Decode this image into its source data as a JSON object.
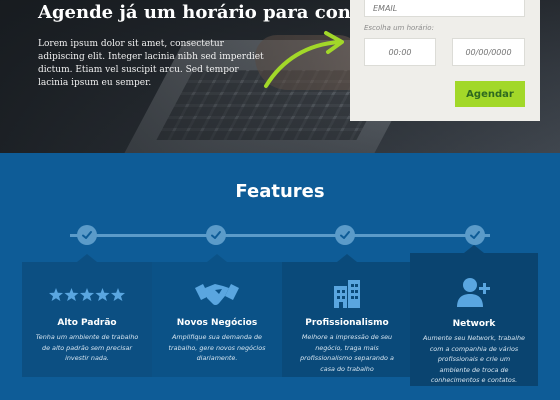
{
  "hero": {
    "title": "Agende já um horário para conhecer!",
    "text": "Lorem ipsum dolor sit amet, consectetur adipiscing elit. Integer lacinia nibh sed imperdiet dictum. Etiam vel suscipit arcu. Sed tempor lacinia ipsum eu semper."
  },
  "form": {
    "email_placeholder": "EMAIL",
    "schedule_label": "Escolha um horário:",
    "time_placeholder": "00:00",
    "date_placeholder": "00/00/0000",
    "submit_label": "Agendar"
  },
  "features": {
    "title": "Features",
    "cards": [
      {
        "icon": "stars-icon",
        "title": "Alto Padrão",
        "text": "Tenha um ambiente de trabalho de alto padrão sem precisar investir nada."
      },
      {
        "icon": "handshake-icon",
        "title": "Novos Negócios",
        "text": "Amplifique sua demanda de trabalho, gere novos negócios diariamente."
      },
      {
        "icon": "building-icon",
        "title": "Profissionalismo",
        "text": "Melhore a impressão de seu negócio, traga mais profissionalismo separando a casa do trabalho"
      },
      {
        "icon": "add-user-icon",
        "title": "Network",
        "text": "Aumente seu Network, trabalhe com a companhia de vários profissionais e crie um ambiente de troca de conhecimentos e contatos."
      }
    ]
  },
  "colors": {
    "accent_green": "#a2d829",
    "features_bg": "#0e5c97",
    "timeline": "#5b9bc9",
    "form_bg": "#efeeea"
  }
}
